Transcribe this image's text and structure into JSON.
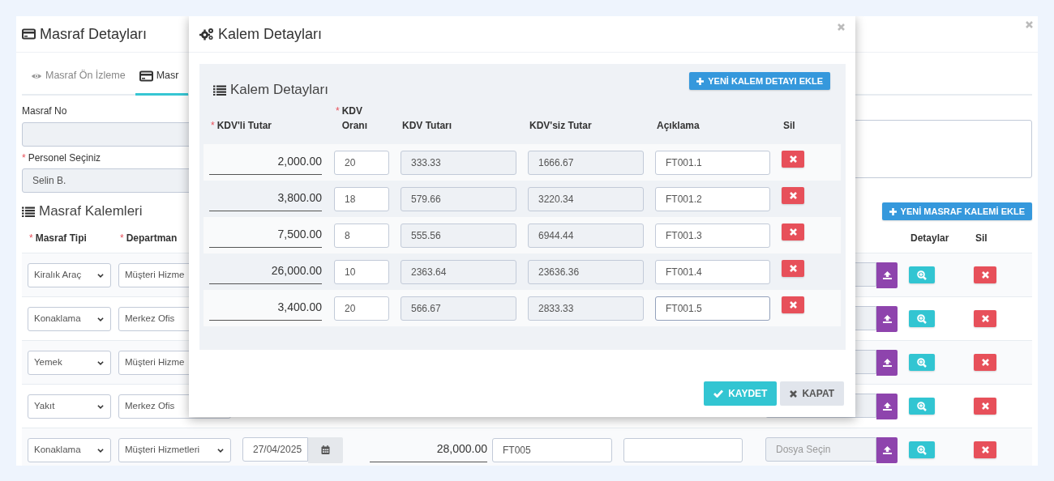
{
  "page": {
    "title": "Masraf Detayları"
  },
  "tabs": [
    {
      "label": "Masraf Ön İzleme",
      "selected": false
    },
    {
      "label": "Masr",
      "selected": true
    }
  ],
  "form": {
    "expense_no": {
      "label": "Masraf No"
    },
    "personnel": {
      "mark": "*",
      "label": "Personel Seçiniz",
      "value": "Selin B."
    }
  },
  "items_title": "Masraf Kalemleri",
  "add_item_button": "YENİ MASRAF KALEMİ EKLE",
  "items_columns": [
    {
      "mark": "*",
      "label": "Masraf Tipi"
    },
    {
      "mark": "*",
      "label": "Departman"
    },
    {
      "label": "Detaylar"
    },
    {
      "label": "Sil"
    }
  ],
  "items": [
    {
      "type": "Kiralık Araç",
      "department": "Müşteri Hizme"
    },
    {
      "type": "Konaklama",
      "department": "Merkez Ofis"
    },
    {
      "type": "Yemek",
      "department": "Müşteri Hizme"
    },
    {
      "type": "Yakıt",
      "department": "Merkez Ofis"
    },
    {
      "type": "Konaklama",
      "department": "Müşteri Hizmetleri",
      "date": "27/04/2025",
      "amount": "28,000.00",
      "invoice": "FT005",
      "file_placeholder": "Dosya Seçin"
    }
  ],
  "modal": {
    "title": "Kalem Detayları",
    "panel_title": "Kalem Detayları",
    "add_button": "YENİ KALEM DETAYI EKLE",
    "columns": [
      {
        "mark": "*",
        "label": "KDV'li Tutar"
      },
      {
        "mark": "*",
        "label": "KDV Oranı"
      },
      {
        "label": "KDV Tutarı"
      },
      {
        "label": "KDV'siz Tutar"
      },
      {
        "label": "Açıklama"
      },
      {
        "label": "Sil"
      }
    ],
    "rows": [
      {
        "gross": "2,000.00",
        "rate": "20",
        "vat": "333.33",
        "net": "1666.67",
        "description": "FT001.1",
        "focused": false
      },
      {
        "gross": "3,800.00",
        "rate": "18",
        "vat": "579.66",
        "net": "3220.34",
        "description": "FT001.2",
        "focused": false
      },
      {
        "gross": "7,500.00",
        "rate": "8",
        "vat": "555.56",
        "net": "6944.44",
        "description": "FT001.3",
        "focused": false
      },
      {
        "gross": "26,000.00",
        "rate": "10",
        "vat": "2363.64",
        "net": "23636.36",
        "description": "FT001.4",
        "focused": false
      },
      {
        "gross": "3,400.00",
        "rate": "20",
        "vat": "566.67",
        "net": "2833.33",
        "description": "FT001.5",
        "focused": true
      }
    ],
    "save_button": "KAYDET",
    "close_button": "KAPAT"
  }
}
